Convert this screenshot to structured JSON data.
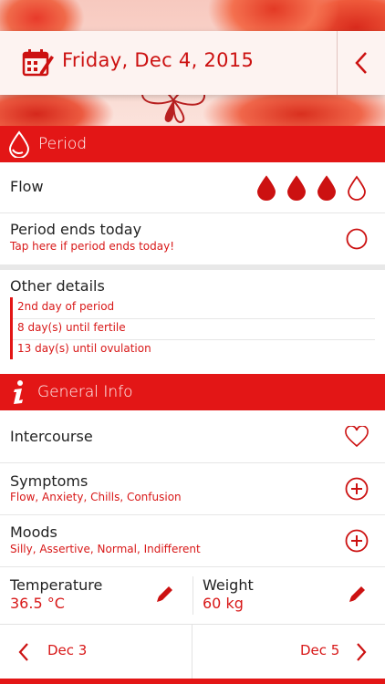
{
  "header": {
    "date": "Friday, Dec 4, 2015"
  },
  "period_section": {
    "title": "Period",
    "flow_label": "Flow",
    "flow_level": 3,
    "flow_max": 4,
    "ends_title": "Period ends today",
    "ends_subtitle": "Tap here if period ends today!",
    "details_title": "Other details",
    "details": [
      "2nd day of period",
      "8 day(s) until fertile",
      "13 day(s) until ovulation"
    ]
  },
  "general_section": {
    "title": "General Info",
    "intercourse_label": "Intercourse",
    "symptoms_label": "Symptoms",
    "symptoms_value": "Flow, Anxiety, Chills, Confusion",
    "moods_label": "Moods",
    "moods_value": "Silly, Assertive, Normal, Indifferent",
    "temperature_label": "Temperature",
    "temperature_value": "36.5 °C",
    "weight_label": "Weight",
    "weight_value": "60 kg"
  },
  "footer": {
    "prev_date": "Dec 3",
    "next_date": "Dec 5"
  },
  "colors": {
    "accent": "#e31616",
    "text_red": "#d81818"
  },
  "icons": [
    "calendar-edit-icon",
    "chevron-left-icon",
    "drop-icon",
    "info-icon",
    "heart-icon",
    "plus-circle-icon",
    "pencil-icon",
    "chevron-right-icon"
  ]
}
